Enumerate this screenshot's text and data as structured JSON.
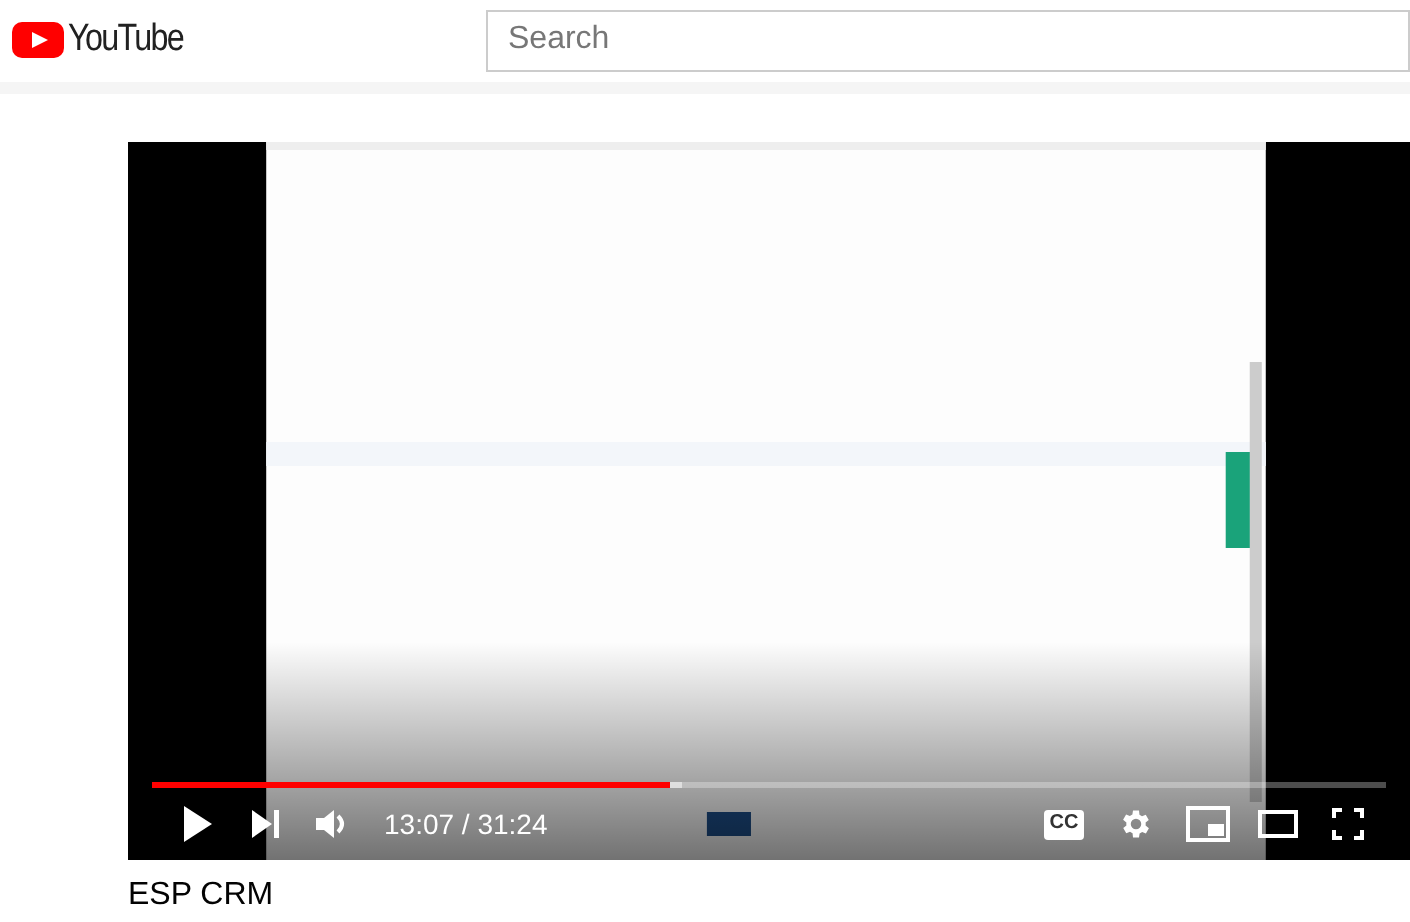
{
  "header": {
    "logo_text": "YouTube",
    "search": {
      "placeholder": "Search"
    }
  },
  "player": {
    "progress": {
      "level": 0.42
    },
    "time": "13:07 / 31:24",
    "captions_label": "CC"
  },
  "video_title": "ESP CRM"
}
